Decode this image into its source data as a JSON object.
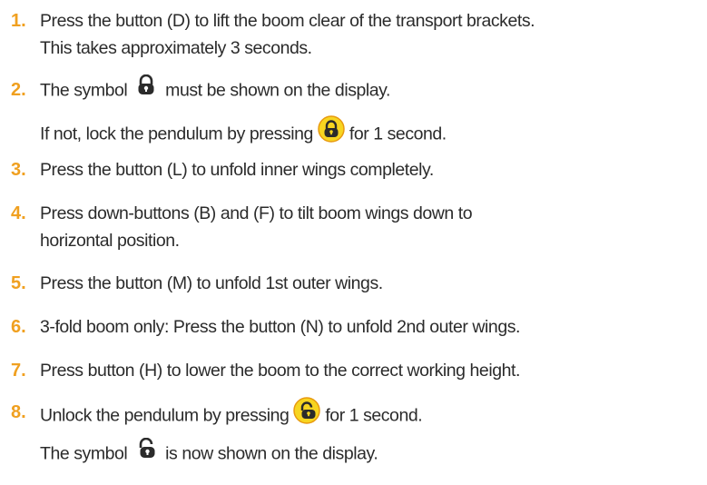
{
  "steps": [
    {
      "number": "1.",
      "lines": [
        "Press the button (D) to lift the boom clear of the transport brackets.",
        "This takes approximately 3 seconds."
      ]
    },
    {
      "number": "2.",
      "text_before": "The symbol",
      "text_after": "must be shown on the display.",
      "icon": "lock-closed-icon",
      "note_before": "If not, lock the pendulum by pressing",
      "note_after": "for 1 second.",
      "note_icon": "lock-button-icon"
    },
    {
      "number": "3.",
      "lines": [
        "Press the button (L) to unfold inner wings completely."
      ]
    },
    {
      "number": "4.",
      "lines": [
        "Press down-buttons (B) and (F) to tilt boom wings down to",
        "horizontal position."
      ]
    },
    {
      "number": "5.",
      "lines": [
        "Press the button (M) to unfold 1st outer wings."
      ]
    },
    {
      "number": "6.",
      "lines": [
        "3-fold boom only: Press the button (N) to unfold 2nd outer wings."
      ]
    },
    {
      "number": "7.",
      "lines": [
        "Press button (H) to lower the boom to the correct working height."
      ]
    },
    {
      "number": "8.",
      "text_before": "Unlock the pendulum by pressing",
      "text_after": "for 1 second.",
      "icon": "unlock-button-icon",
      "note_before": "The symbol",
      "note_after": "is now shown on the display.",
      "note_icon": "lock-open-icon"
    }
  ],
  "colors": {
    "text": "#2b2b2b",
    "number": "#f0a020",
    "button_fill": "#f7d520",
    "button_ring": "#e89a10"
  }
}
